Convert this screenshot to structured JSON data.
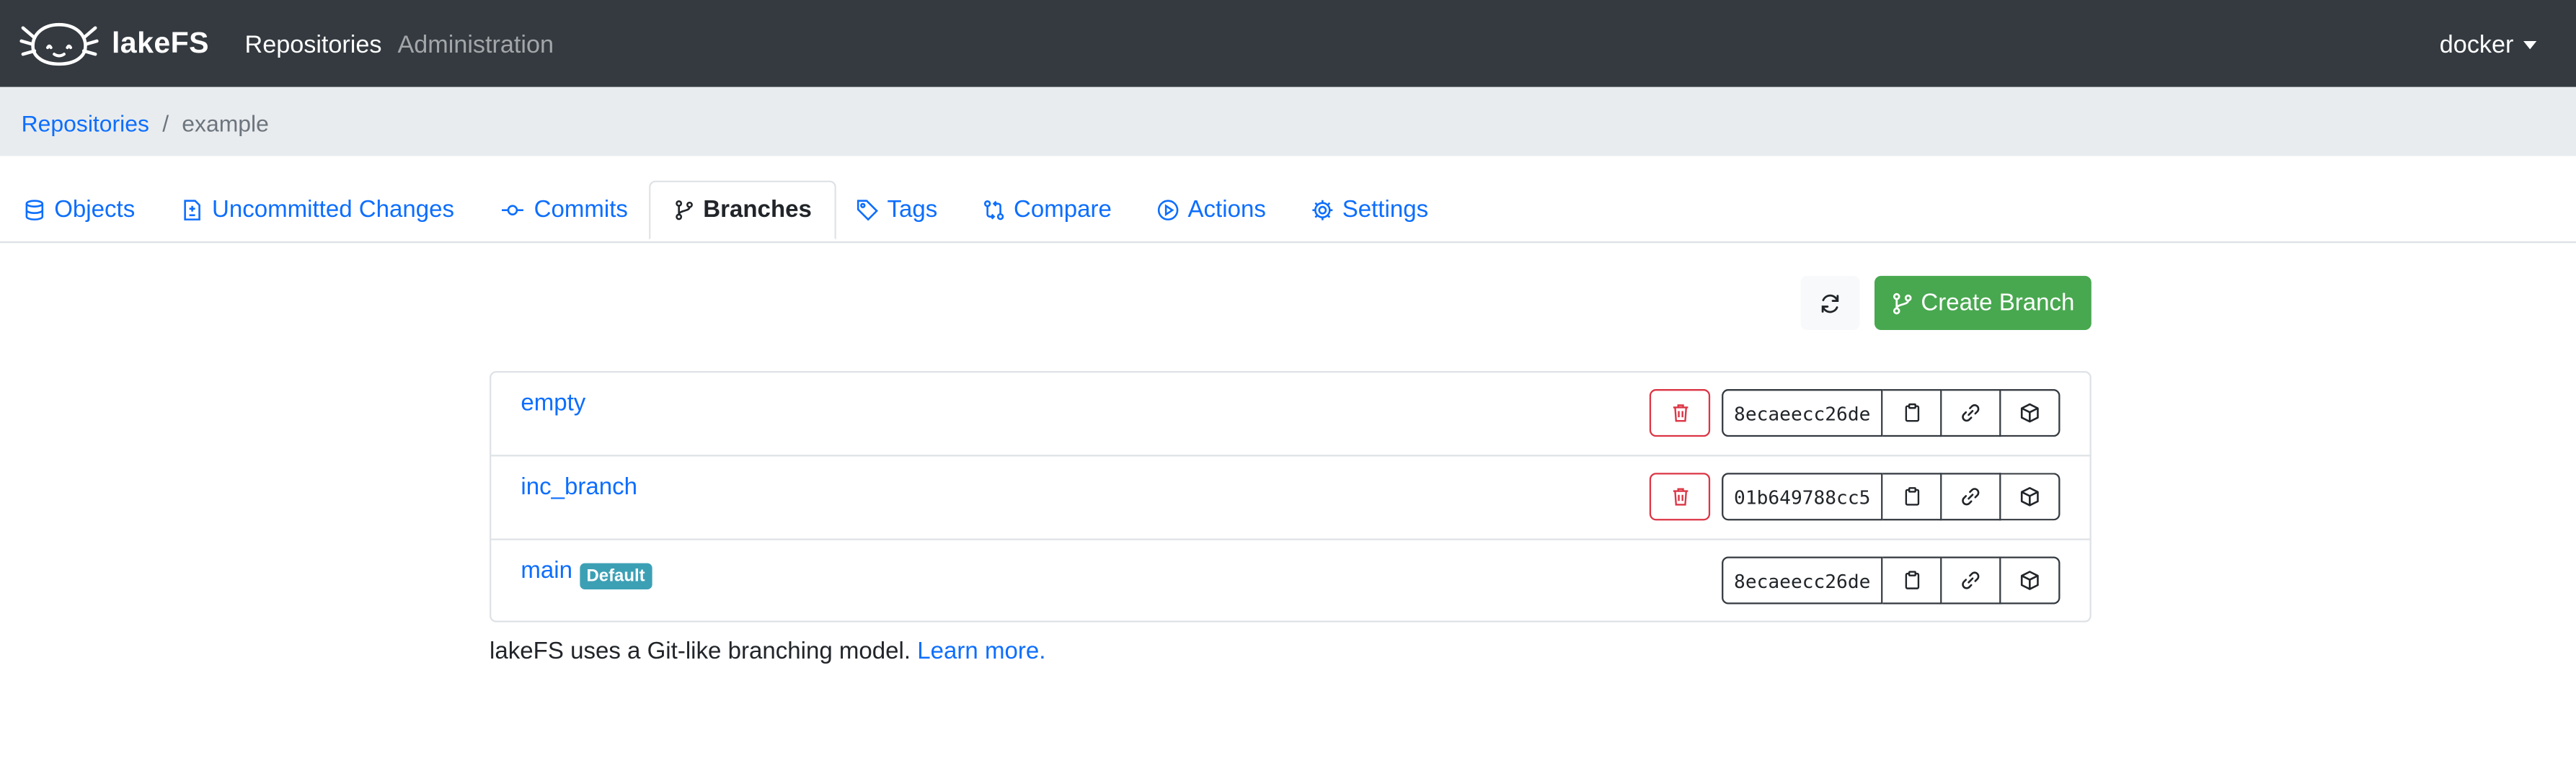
{
  "app": {
    "brand": "lakeFS",
    "nav": {
      "repositories": "Repositories",
      "administration": "Administration"
    },
    "user": "docker"
  },
  "breadcrumb": {
    "root": "Repositories",
    "separator": "/",
    "current": "example"
  },
  "tabs": [
    {
      "label": "Objects",
      "icon": "database-icon",
      "active": false
    },
    {
      "label": "Uncommitted Changes",
      "icon": "file-diff-icon",
      "active": false
    },
    {
      "label": "Commits",
      "icon": "git-commit-icon",
      "active": false
    },
    {
      "label": "Branches",
      "icon": "git-branch-icon",
      "active": true
    },
    {
      "label": "Tags",
      "icon": "tag-icon",
      "active": false
    },
    {
      "label": "Compare",
      "icon": "git-compare-icon",
      "active": false
    },
    {
      "label": "Actions",
      "icon": "play-icon",
      "active": false
    },
    {
      "label": "Settings",
      "icon": "gear-icon",
      "active": false
    }
  ],
  "toolbar": {
    "refresh_icon": "refresh-icon",
    "create_branch": "Create Branch"
  },
  "branches": [
    {
      "name": "empty",
      "commit": "8ecaeecc26de",
      "default": false,
      "deletable": true
    },
    {
      "name": "inc_branch",
      "commit": "01b649788cc5",
      "default": false,
      "deletable": true
    },
    {
      "name": "main",
      "commit": "8ecaeecc26de",
      "default": true,
      "badge": "Default",
      "deletable": false
    }
  ],
  "footer": {
    "text": "lakeFS uses a Git-like branching model.",
    "link": "Learn more."
  },
  "colors": {
    "navbar": "#343a40",
    "link": "#0d6efd",
    "success": "#48a84f",
    "danger": "#dc3545",
    "badge": "#3ca0b5",
    "breadcrumb_bg": "#e9ecef"
  }
}
